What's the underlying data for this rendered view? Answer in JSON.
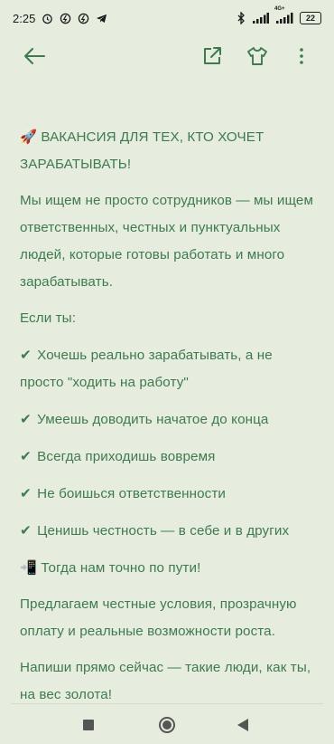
{
  "status_bar": {
    "time": "2:25",
    "battery": "22",
    "network": "4G+"
  },
  "app_bar": {
    "back_icon": "arrow-left-icon",
    "share_icon": "open-external-icon",
    "shirt_icon": "tshirt-icon",
    "more_icon": "more-vertical-icon"
  },
  "post": {
    "title_emoji": "🚀",
    "title": "ВАКАНСИЯ ДЛЯ ТЕХ, КТО ХОЧЕТ ЗАРАБАТЫВАТЬ!",
    "intro": "Мы ищем не просто сотрудников — мы ищем ответственных, честных и пунктуальных людей, которые готовы работать и много зарабатывать.",
    "if_you": "Если ты:",
    "check_mark": "✔",
    "items": [
      "Хочешь реально зарабатывать, а не просто \"ходить на работу\"",
      "Умеешь доводить начатое до конца",
      "Всегда приходишь вовремя",
      "Не боишься ответственности",
      "Ценишь честность — в себе и в других"
    ],
    "phone_emoji": "📲",
    "path_line": "Тогда нам точно по пути!",
    "offer": "Предлагаем честные условия, прозрачную оплату и реальные возможности роста.",
    "cta": "Напиши прямо сейчас — такие люди, как ты, на вес золота!"
  },
  "colors": {
    "background": "#e6eddf",
    "text": "#3f7a4f",
    "nav": "#555555"
  }
}
